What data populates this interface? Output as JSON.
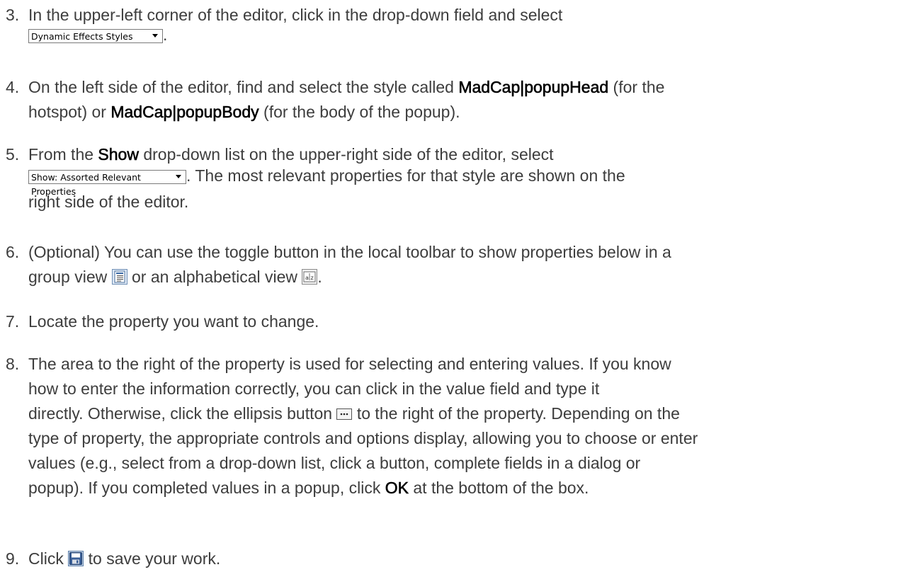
{
  "steps": [
    {
      "num": "3.",
      "parts": [
        "In the upper-left corner of the editor, click in the drop-down field and select",
        "."
      ],
      "dropdown": "Dynamic Effects Styles"
    },
    {
      "num": "4.",
      "parts": [
        "On the left side of the editor, find and select the style called ",
        "MadCap|popupHead",
        " (for the",
        "hotspot) or ",
        "MadCap|popupBody",
        " (for the body of the popup)."
      ]
    },
    {
      "num": "5.",
      "parts": [
        "From the ",
        "Show",
        " drop-down list on the upper-right side of the editor, select",
        ". The most relevant properties for that style are shown on the",
        "right side of the editor."
      ],
      "dropdown": "Show: Assorted Relevant Properties"
    },
    {
      "num": "6.",
      "parts": [
        "(Optional) You can use the toggle button in the local toolbar to show properties below in a",
        "group view ",
        " or an alphabetical view ",
        "."
      ]
    },
    {
      "num": "7.",
      "parts": [
        "Locate the property you want to change."
      ]
    },
    {
      "num": "8.",
      "lines": [
        "The area to the right of the property is used for selecting and entering values. If you know",
        "how to enter the information correctly, you can click in the value field and type it",
        "directly. Otherwise, click the ellipsis button ",
        " to the right of the property. Depending on the",
        "type of property, the appropriate controls and options display, allowing you to choose or enter",
        "values (e.g., select from a drop-down list, click a button, complete fields in a dialog or",
        "popup). If you completed values in a popup, click ",
        "OK",
        " at the bottom of the box."
      ]
    },
    {
      "num": "9.",
      "parts": [
        "Click ",
        " to save your work."
      ]
    }
  ],
  "icons": {
    "group_view": "group-view-icon",
    "alpha_view": "alphabetical-view-icon",
    "ellipsis": "ellipsis-button-icon",
    "save": "save-icon"
  }
}
